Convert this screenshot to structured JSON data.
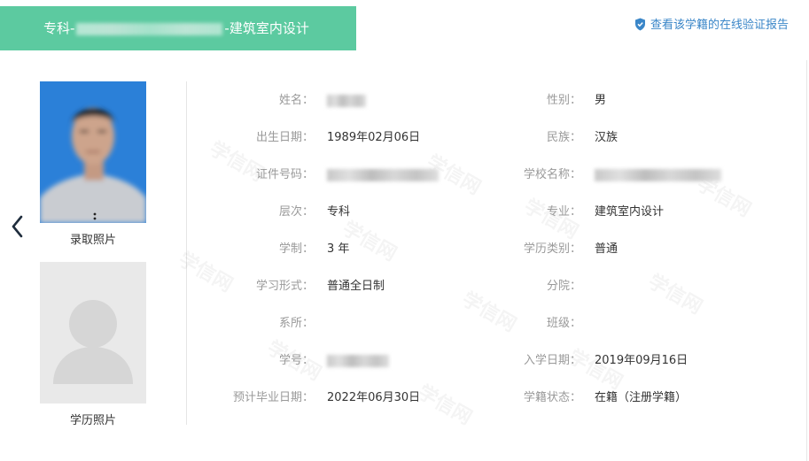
{
  "header": {
    "title_prefix": "专科-",
    "title_suffix": "-建筑室内设计",
    "verify_link_label": "查看该学籍的在线验证报告",
    "accent_color": "#5ccaa0",
    "link_color": "#3a86c8"
  },
  "photos": {
    "admission_caption": "录取照片",
    "education_caption": "学历照片"
  },
  "fields": {
    "name": {
      "label": "姓名："
    },
    "gender": {
      "label": "性别：",
      "value": "男"
    },
    "birthdate": {
      "label": "出生日期：",
      "value": "1989年02月06日"
    },
    "ethnicity": {
      "label": "民族：",
      "value": "汉族"
    },
    "id_number": {
      "label": "证件号码："
    },
    "school": {
      "label": "学校名称："
    },
    "level": {
      "label": "层次：",
      "value": "专科"
    },
    "major": {
      "label": "专业：",
      "value": "建筑室内设计"
    },
    "duration": {
      "label": "学制：",
      "value": "3 年"
    },
    "edu_category": {
      "label": "学历类别：",
      "value": "普通"
    },
    "study_form": {
      "label": "学习形式：",
      "value": "普通全日制"
    },
    "branch": {
      "label": "分院：",
      "value": ""
    },
    "department": {
      "label": "系所：",
      "value": ""
    },
    "class": {
      "label": "班级：",
      "value": ""
    },
    "student_id": {
      "label": "学号："
    },
    "enroll_date": {
      "label": "入学日期：",
      "value": "2019年09月16日"
    },
    "grad_date": {
      "label": "预计毕业日期：",
      "value": "2022年06月30日"
    },
    "status": {
      "label": "学籍状态：",
      "value": "在籍（注册学籍）"
    }
  },
  "watermark_text": "学信网"
}
